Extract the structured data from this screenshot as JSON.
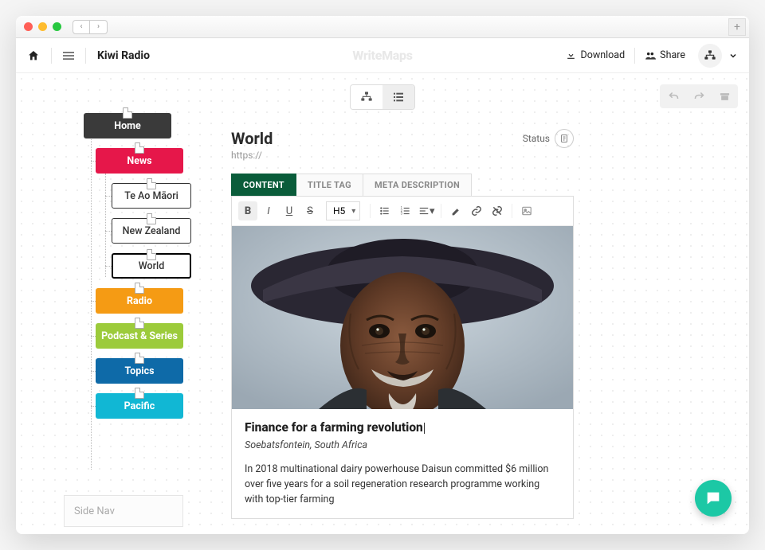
{
  "site_name": "Kiwi Radio",
  "brand": "WriteMaps",
  "top_actions": {
    "download": "Download",
    "share": "Share"
  },
  "sitemap": {
    "home": "Home",
    "items": [
      {
        "label": "News",
        "color": "c-red",
        "children": [
          {
            "label": "Te Ao Māori"
          },
          {
            "label": "New Zealand"
          },
          {
            "label": "World",
            "active": true
          }
        ]
      },
      {
        "label": "Radio",
        "color": "c-orange"
      },
      {
        "label": "Podcast & Series",
        "color": "c-green"
      },
      {
        "label": "Topics",
        "color": "c-blue"
      },
      {
        "label": "Pacific",
        "color": "c-cyan"
      }
    ]
  },
  "sidenav_label": "Side Nav",
  "editor": {
    "title": "World",
    "url": "https://",
    "status_label": "Status",
    "tabs": [
      "CONTENT",
      "TITLE TAG",
      "META DESCRIPTION"
    ],
    "active_tab": 0,
    "heading_select": "H5",
    "article": {
      "headline": "Finance for a farming revolution",
      "subhead": "Soebatsfontein, South Africa",
      "paragraph": "In 2018 multinational dairy powerhouse Daisun committed $6 million over five years for a soil regeneration research programme working with top-tier farming"
    }
  }
}
